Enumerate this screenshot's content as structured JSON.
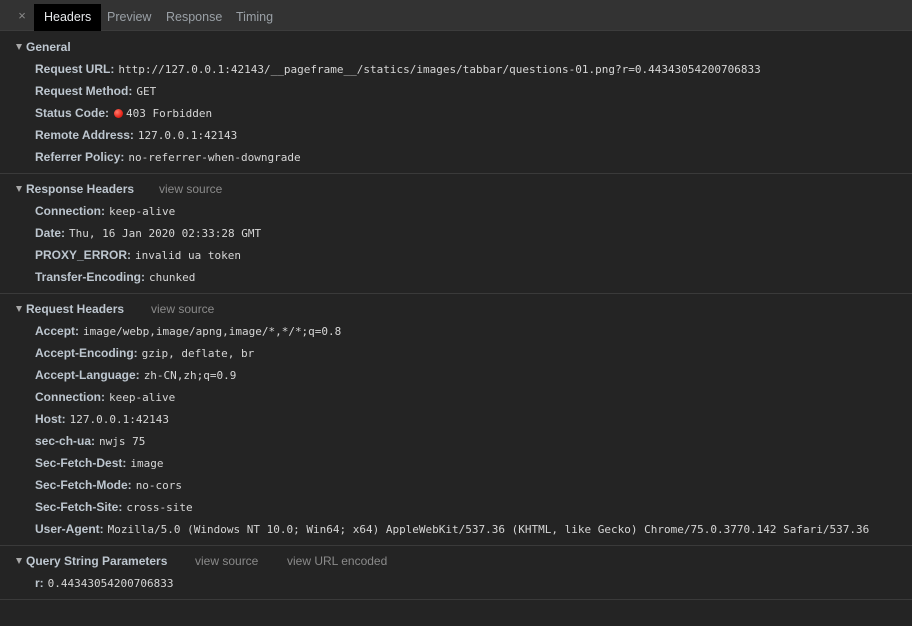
{
  "tabs": {
    "close_label": "×",
    "items": [
      {
        "label": "Headers"
      },
      {
        "label": "Preview"
      },
      {
        "label": "Response"
      },
      {
        "label": "Timing"
      }
    ]
  },
  "general": {
    "title": "General",
    "rows": [
      {
        "key": "Request URL:",
        "value": "http://127.0.0.1:42143/__pageframe__/statics/images/tabbar/questions-01.png?r=0.44343054200706833"
      },
      {
        "key": "Request Method:",
        "value": "GET"
      },
      {
        "key": "Status Code:",
        "value": "403 Forbidden"
      },
      {
        "key": "Remote Address:",
        "value": "127.0.0.1:42143"
      },
      {
        "key": "Referrer Policy:",
        "value": "no-referrer-when-downgrade"
      }
    ],
    "status_color": "#e8261b"
  },
  "response_headers": {
    "title": "Response Headers",
    "view_source": "view source",
    "rows": [
      {
        "key": "Connection:",
        "value": "keep-alive"
      },
      {
        "key": "Date:",
        "value": "Thu, 16 Jan 2020 02:33:28 GMT"
      },
      {
        "key": "PROXY_ERROR:",
        "value": "invalid ua token"
      },
      {
        "key": "Transfer-Encoding:",
        "value": "chunked"
      }
    ]
  },
  "request_headers": {
    "title": "Request Headers",
    "view_source": "view source",
    "rows": [
      {
        "key": "Accept:",
        "value": "image/webp,image/apng,image/*,*/*;q=0.8"
      },
      {
        "key": "Accept-Encoding:",
        "value": "gzip, deflate, br"
      },
      {
        "key": "Accept-Language:",
        "value": "zh-CN,zh;q=0.9"
      },
      {
        "key": "Connection:",
        "value": "keep-alive"
      },
      {
        "key": "Host:",
        "value": "127.0.0.1:42143"
      },
      {
        "key": "sec-ch-ua:",
        "value": "nwjs 75"
      },
      {
        "key": "Sec-Fetch-Dest:",
        "value": "image"
      },
      {
        "key": "Sec-Fetch-Mode:",
        "value": "no-cors"
      },
      {
        "key": "Sec-Fetch-Site:",
        "value": "cross-site"
      },
      {
        "key": "User-Agent:",
        "value": "Mozilla/5.0 (Windows NT 10.0; Win64; x64) AppleWebKit/537.36 (KHTML, like Gecko) Chrome/75.0.3770.142 Safari/537.36"
      }
    ]
  },
  "query_params": {
    "title": "Query String Parameters",
    "view_source": "view source",
    "view_url_encoded": "view URL encoded",
    "rows": [
      {
        "key": "r:",
        "value": "0.44343054200706833"
      }
    ]
  }
}
